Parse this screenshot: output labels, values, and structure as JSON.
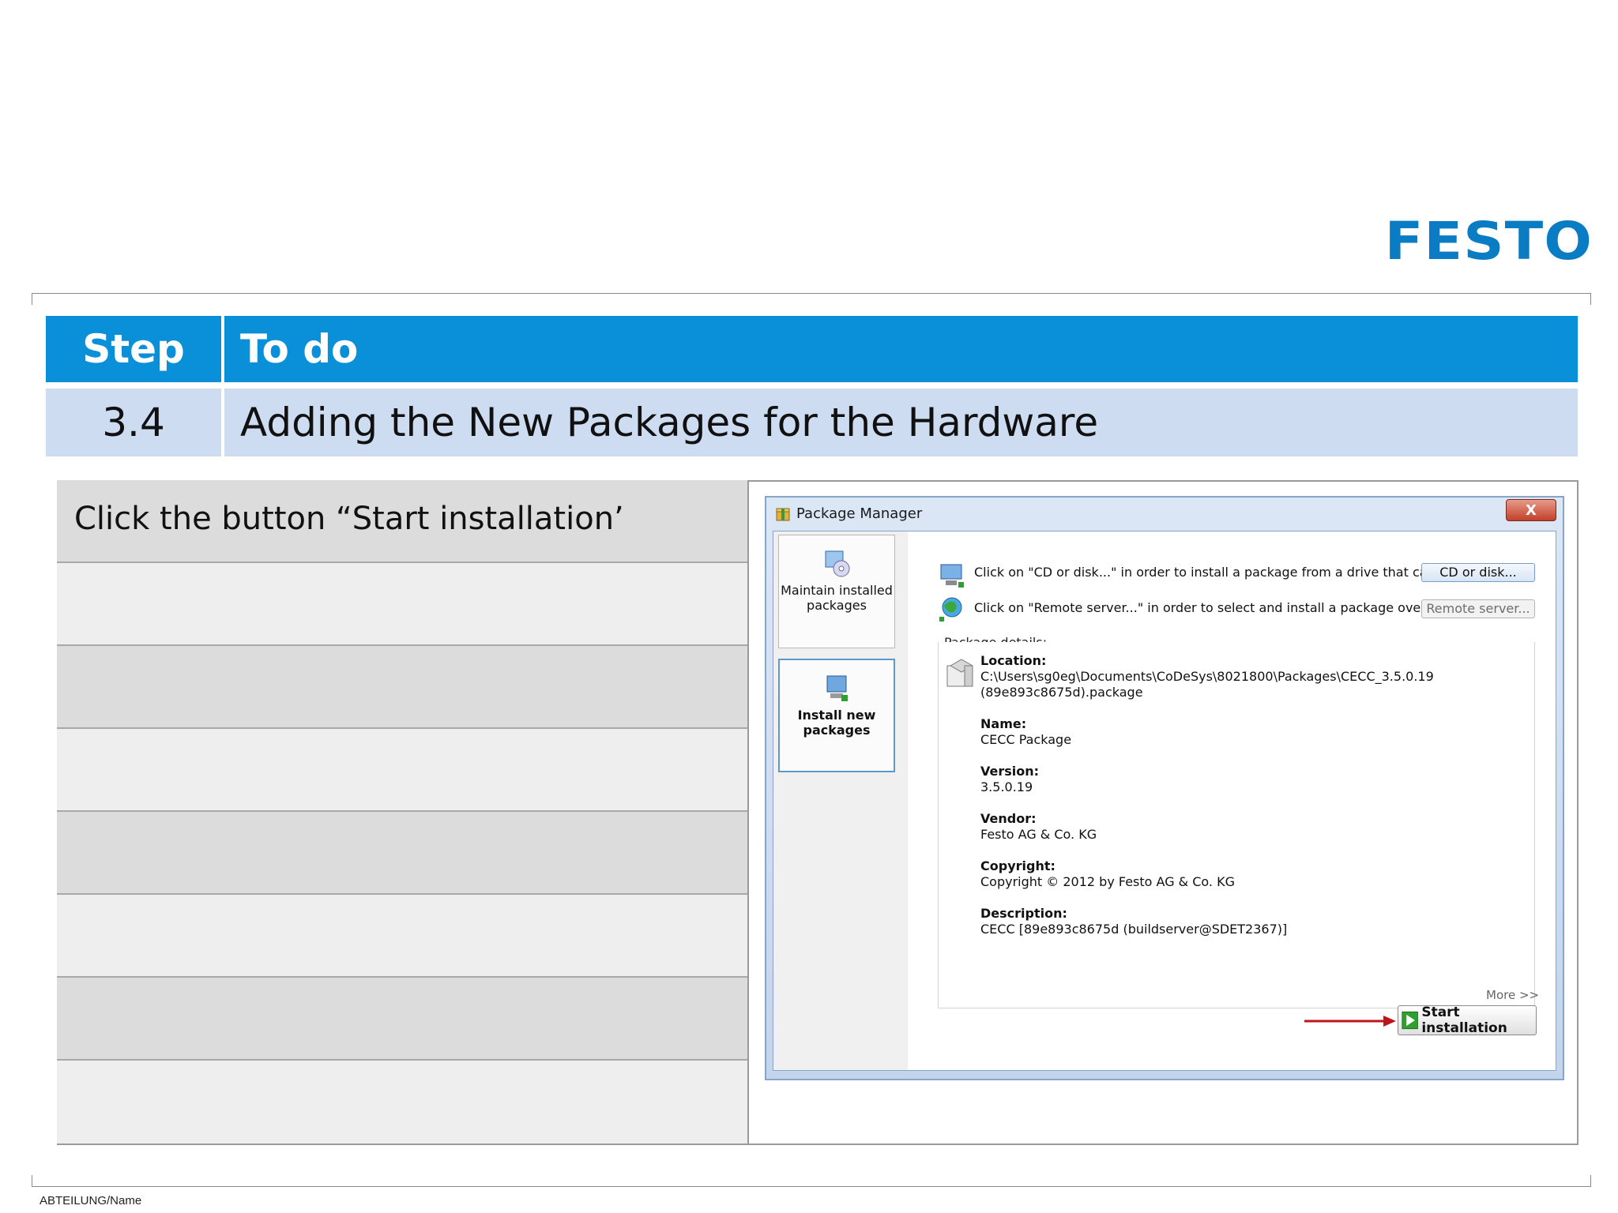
{
  "brand": {
    "logo_text": "FESTO",
    "color": "#0a7cc4"
  },
  "table": {
    "header_step": "Step",
    "header_todo": "To do",
    "step_number": "3.4",
    "step_title": "Adding the New Packages for the Hardware",
    "header_color": "#0a8fd9",
    "row_color": "#cddcf1"
  },
  "instructions": [
    "Click the button “Start installation’",
    "",
    "",
    "",
    "",
    "",
    "",
    ""
  ],
  "footer": {
    "text": "ABTEILUNG/Name"
  },
  "package_manager": {
    "title": "Package Manager",
    "close_label": "X",
    "side": {
      "maintain_label": "Maintain installed packages",
      "install_label": "Install new packages"
    },
    "cd_text": "Click on \"CD or disk...\" in order to install a package from a drive that can be",
    "cd_button": "CD or disk...",
    "remote_text": "Click on \"Remote server...\" in order to select and install a package over the",
    "remote_button": "Remote server...",
    "details_label": "Package details:",
    "location_label": "Location:",
    "location_value_1": "C:\\Users\\sg0eg\\Documents\\CoDeSys\\8021800\\Packages\\CECC_3.5.0.19",
    "location_value_2": "(89e893c8675d).package",
    "name_label": "Name:",
    "name_value": "CECC Package",
    "version_label": "Version:",
    "version_value": "3.5.0.19",
    "vendor_label": "Vendor:",
    "vendor_value": "Festo AG & Co. KG",
    "copyright_label": "Copyright:",
    "copyright_value": "Copyright © 2012 by Festo AG & Co. KG",
    "description_label": "Description:",
    "description_value": "CECC [89e893c8675d (buildserver@SDET2367)]",
    "more_link": "More >>",
    "start_button": "Start installation",
    "arrow_color": "#c0141c"
  }
}
